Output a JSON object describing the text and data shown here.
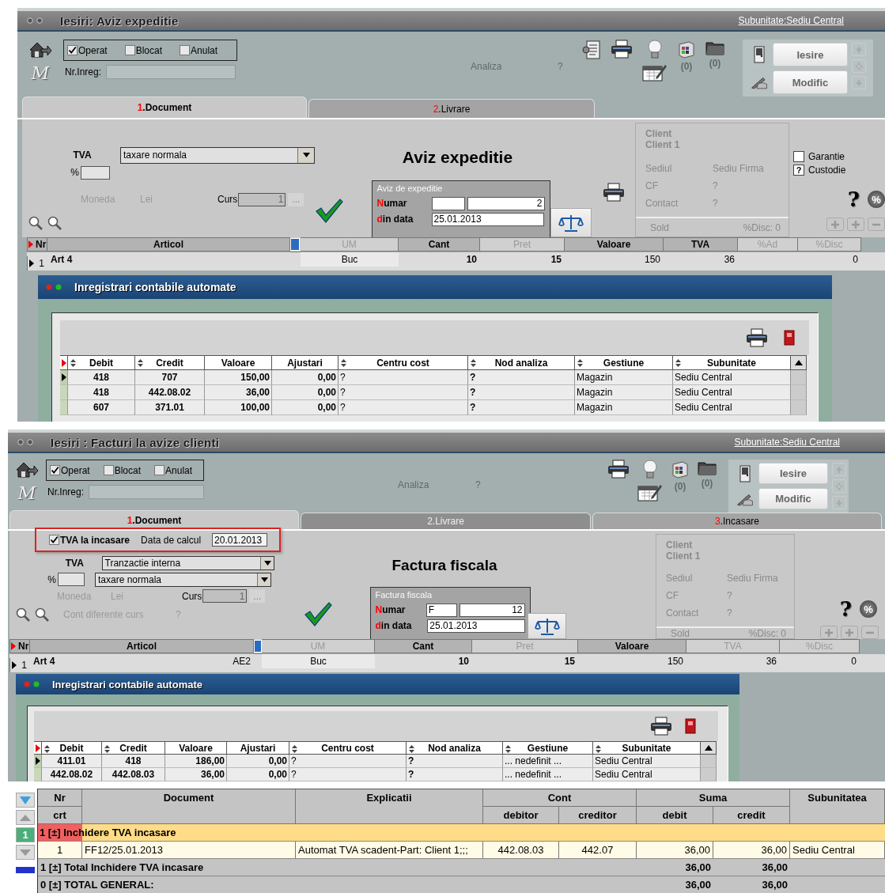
{
  "windows": [
    {
      "title": "Iesiri: Aviz expeditie",
      "subunit": "Subunitate:Sediu Central",
      "logo_letter": "M",
      "status_checks": [
        {
          "label": "Operat",
          "checked": true
        },
        {
          "label": "Blocat",
          "checked": false
        },
        {
          "label": "Anulat",
          "checked": false
        }
      ],
      "nr_inreg_label": "Nr.Inreg:",
      "analiza": {
        "label": "Analiza",
        "value": "?"
      },
      "toolbar_icons": [
        {
          "kind": "document"
        },
        {
          "kind": "printer"
        },
        {
          "kind": "bulb"
        },
        {
          "kind": "calendar"
        },
        {
          "kind": "cube",
          "count": "(0)"
        },
        {
          "kind": "folder",
          "count": "(0)"
        }
      ],
      "buttons": [
        {
          "kind": "exit",
          "label": "Iesire"
        },
        {
          "kind": "edit",
          "label": "Modific"
        }
      ],
      "tabs": [
        {
          "number": "1",
          "label": ".Document",
          "selected": true,
          "disabled": false
        },
        {
          "number": "2",
          "label": ".Livrare",
          "selected": false,
          "disabled": false
        }
      ],
      "tva": {
        "label": "TVA",
        "selects": [
          "taxare normala"
        ],
        "percent_label": "%"
      },
      "moneda": {
        "label": "Moneda",
        "value": "Lei"
      },
      "curs": {
        "label": "Curs",
        "value": "1",
        "button": "..."
      },
      "doc_title": "Aviz expeditie",
      "doc_box": {
        "legend": "Aviz de expeditie",
        "numar_label": "Numar",
        "number": "2",
        "date_label": "din data",
        "date": "25.01.2013"
      },
      "doc_tools": [
        {
          "kind": "printer"
        }
      ],
      "client": {
        "label": "Client",
        "name": "Client 1",
        "rows": [
          {
            "label": "Sediul",
            "value": "Sediu Firma"
          },
          {
            "label": "CF",
            "value": "?"
          },
          {
            "label": "Contact",
            "value": "?"
          }
        ],
        "sold_label": "Sold",
        "disc": "%Disc: 0"
      },
      "options": [
        {
          "kind": "checkbox",
          "label": "Garantie",
          "checked": false
        },
        {
          "kind": "query",
          "label": "Custodie",
          "mark": "?"
        }
      ],
      "help_glyph": "?",
      "percent_glyph": "%",
      "grid": {
        "columns": [
          {
            "kind": "nr",
            "label": "Nr",
            "active": true
          },
          {
            "kind": "articol",
            "label": "Articol",
            "active": true
          },
          {
            "kind": "um",
            "label": "UM",
            "active": false
          },
          {
            "kind": "cant",
            "label": "Cant",
            "active": true
          },
          {
            "kind": "pret",
            "label": "Pret",
            "active": false
          },
          {
            "kind": "valoare",
            "label": "Valoare",
            "active": true
          },
          {
            "kind": "tva",
            "label": "TVA",
            "active": true
          },
          {
            "kind": "ad",
            "label": "%Ad",
            "active": false
          },
          {
            "kind": "disc",
            "label": "%Disc",
            "active": false
          }
        ],
        "rows": [
          {
            "nr": "1",
            "articol": "Art 4",
            "um": "Buc",
            "cant": "10",
            "pret": "15",
            "valoare": "150",
            "tva": "36",
            "disc": "0"
          }
        ]
      },
      "dialog": {
        "title": "Inregistrari contabile automate",
        "columns": [
          {
            "label": "Debit",
            "sortable": true
          },
          {
            "label": "Credit",
            "sortable": true
          },
          {
            "label": "Valoare",
            "sortable": false
          },
          {
            "label": "Ajustari",
            "sortable": false
          },
          {
            "label": "Centru cost",
            "sortable": true
          },
          {
            "label": "Nod analiza",
            "sortable": true
          },
          {
            "label": "Gestiune",
            "sortable": true
          },
          {
            "label": "Subunitate",
            "sortable": true
          }
        ],
        "rows": [
          {
            "selected": true,
            "cells": [
              "418",
              "707",
              "150,00",
              "0,00",
              "?",
              "?",
              "Magazin",
              "Sediu Central"
            ]
          },
          {
            "selected": false,
            "cells": [
              "418",
              "442.08.02",
              "36,00",
              "0,00",
              "?",
              "?",
              "Magazin",
              "Sediu Central"
            ]
          },
          {
            "selected": false,
            "cells": [
              "607",
              "371.01",
              "100,00",
              "0,00",
              "?",
              "?",
              "Magazin",
              "Sediu Central"
            ]
          }
        ]
      }
    },
    {
      "title": "Iesiri : Facturi la avize clienti",
      "subunit": "Subunitate:Sediu Central",
      "logo_letter": "M",
      "status_checks": [
        {
          "label": "Operat",
          "checked": true
        },
        {
          "label": "Blocat",
          "checked": false
        },
        {
          "label": "Anulat",
          "checked": false
        }
      ],
      "nr_inreg_label": "Nr.Inreg:",
      "analiza": {
        "label": "Analiza",
        "value": "?"
      },
      "toolbar_icons": [
        {
          "kind": "printer"
        },
        {
          "kind": "bulb"
        },
        {
          "kind": "calendar"
        },
        {
          "kind": "cube",
          "count": "(0)"
        },
        {
          "kind": "folder",
          "count": "(0)"
        }
      ],
      "buttons": [
        {
          "kind": "exit",
          "label": "Iesire"
        },
        {
          "kind": "edit",
          "label": "Modific"
        }
      ],
      "tabs": [
        {
          "number": "1",
          "label": ".Document",
          "selected": true,
          "disabled": false
        },
        {
          "number": "2",
          "label": ".Livrare",
          "selected": false,
          "disabled": true
        },
        {
          "number": "3",
          "label": ".Incasare",
          "selected": false,
          "disabled": false
        }
      ],
      "tva_incasare": {
        "checked": true,
        "label": "TVA la incasare",
        "date_label": "Data de calcul",
        "date": "20.01.2013"
      },
      "tva": {
        "label": "TVA",
        "selects": [
          "Tranzactie interna",
          "taxare normala"
        ],
        "percent_label": "%"
      },
      "moneda": {
        "label": "Moneda",
        "value": "Lei"
      },
      "curs": {
        "label": "Curs",
        "value": "1",
        "button": "..."
      },
      "cont_diferente": {
        "label": "Cont diferente curs",
        "value": "?"
      },
      "doc_title": "Factura fiscala",
      "doc_box": {
        "legend": "Factura fiscala",
        "numar_label": "Numar",
        "series": "F",
        "number": "12",
        "date_label": "din data",
        "date": "25.01.2013"
      },
      "client": {
        "label": "Client",
        "name": "Client 1",
        "rows": [
          {
            "label": "Sediul",
            "value": "Sediu Firma"
          },
          {
            "label": "CF",
            "value": "?"
          },
          {
            "label": "Contact",
            "value": "?"
          }
        ],
        "sold_label": "Sold",
        "disc": "%Disc: 0"
      },
      "help_glyph": "?",
      "percent_glyph": "%",
      "grid": {
        "columns": [
          {
            "kind": "nr",
            "label": "Nr",
            "active": true
          },
          {
            "kind": "articol",
            "label": "Articol",
            "active": true
          },
          {
            "kind": "um",
            "label": "UM",
            "active": false
          },
          {
            "kind": "cant",
            "label": "Cant",
            "active": true
          },
          {
            "kind": "pret",
            "label": "Pret",
            "active": false
          },
          {
            "kind": "valoare",
            "label": "Valoare",
            "active": true
          },
          {
            "kind": "tva",
            "label": "TVA",
            "active": false
          },
          {
            "kind": "disc",
            "label": "%Disc",
            "active": false
          }
        ],
        "rows": [
          {
            "nr": "1",
            "articol": "Art 4",
            "code": "AE2",
            "um": "Buc",
            "cant": "10",
            "pret": "15",
            "valoare": "150",
            "tva": "36",
            "disc": "0"
          }
        ]
      },
      "dialog": {
        "title": "Inregistrari contabile automate",
        "columns": [
          {
            "label": "Debit",
            "sortable": true
          },
          {
            "label": "Credit",
            "sortable": true
          },
          {
            "label": "Valoare",
            "sortable": false
          },
          {
            "label": "Ajustari",
            "sortable": false
          },
          {
            "label": "Centru cost",
            "sortable": true
          },
          {
            "label": "Nod analiza",
            "sortable": true
          },
          {
            "label": "Gestiune",
            "sortable": true
          },
          {
            "label": "Subunitate",
            "sortable": true
          }
        ],
        "rows": [
          {
            "selected": true,
            "cells": [
              "411.01",
              "418",
              "186,00",
              "0,00",
              "?",
              "?",
              "... nedefinit ...",
              "Sediu Central"
            ]
          },
          {
            "selected": false,
            "cells": [
              "442.08.02",
              "442.08.03",
              "36,00",
              "0,00",
              "?",
              "?",
              "... nedefinit ...",
              "Sediu Central"
            ]
          }
        ]
      }
    }
  ],
  "report": {
    "nav_counter": "1",
    "columns": [
      {
        "label": "Nr",
        "subs": [
          "crt"
        ]
      },
      {
        "label": "Document"
      },
      {
        "label": "Explicatii"
      },
      {
        "label": "Cont",
        "subs": [
          "debitor",
          "creditor"
        ]
      },
      {
        "label": "Suma",
        "subs": [
          "debit",
          "credit"
        ]
      },
      {
        "label": "Subunitatea"
      }
    ],
    "rows": [
      {
        "kind": "group",
        "text": "1 [±] Inchidere TVA incasare",
        "selected": true
      },
      {
        "kind": "data",
        "cells": [
          "1",
          "FF12/25.01.2013",
          "Automat TVA scadent-Part: Client 1;;;",
          "442.08.03",
          "442.07",
          "36,00",
          "36,00",
          "Sediu Central"
        ]
      },
      {
        "kind": "total",
        "text": "1 [±] Total Inchidere TVA incasare",
        "debit": "36,00",
        "credit": "36,00"
      },
      {
        "kind": "total",
        "text": "0 [±] TOTAL GENERAL:",
        "debit": "36,00",
        "credit": "36,00"
      }
    ]
  }
}
